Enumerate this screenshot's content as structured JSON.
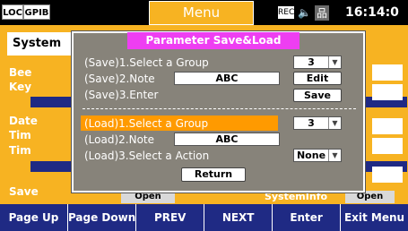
{
  "status_bar": {
    "loc_label": "LOC",
    "gpib_label": "GPIB",
    "title": "Menu",
    "rec_icon_label": "REC",
    "speaker_symbol": "🔈",
    "network_symbol": "品",
    "clock": "16:14:0"
  },
  "main_panel": {
    "active_tab": "System",
    "bg_labels": [
      "Bee",
      "Key",
      "Date",
      "Tim",
      "Tim",
      "Save"
    ],
    "bg_open_1": "Open",
    "bg_open_2": "Open",
    "bg_text": "SystemInfo"
  },
  "dialog": {
    "title": "Parameter Save&Load",
    "save": {
      "group_label": "(Save)1.Select a Group",
      "group_value": "3",
      "note_label": "(Save)2.Note",
      "note_value": "ABC",
      "edit_button": "Edit",
      "enter_label": "(Save)3.Enter",
      "save_button": "Save"
    },
    "load": {
      "group_label": "(Load)1.Select a Group",
      "group_value": "3",
      "note_label": "(Load)2.Note",
      "note_value": "ABC",
      "action_label": "(Load)3.Select a Action",
      "action_value": "None"
    },
    "return_button": "Return",
    "dropdown_arrow": "▼"
  },
  "softkeys": [
    "Page Up",
    "Page Down",
    "PREV",
    "NEXT",
    "Enter",
    "Exit Menu"
  ],
  "colors": {
    "accent_orange": "#f7b322",
    "title_magenta": "#ee3ef2",
    "softkey_blue": "#1f2a84",
    "dialog_gray": "#87837a",
    "highlight_orange": "#ff9a00"
  }
}
